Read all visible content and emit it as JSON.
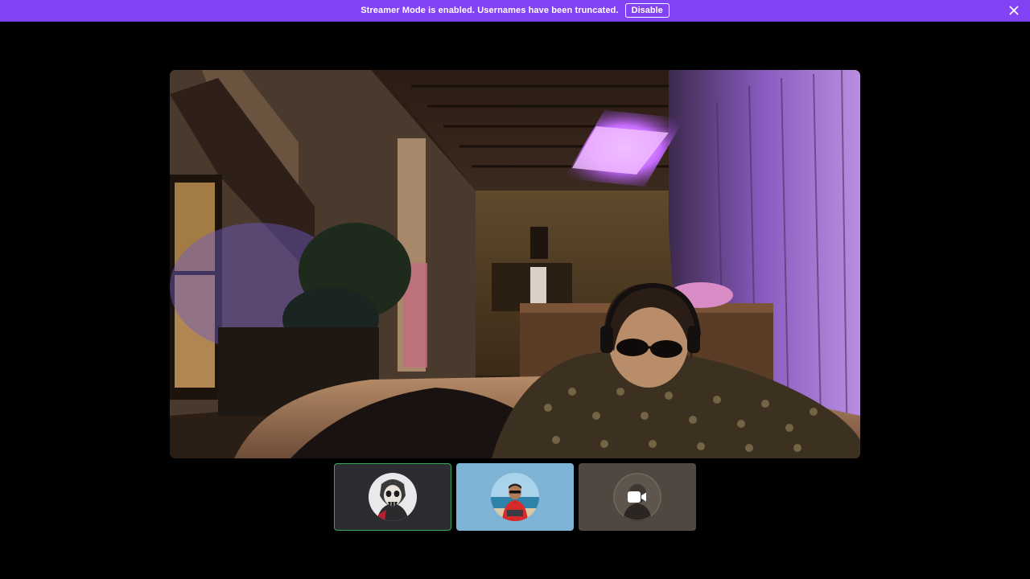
{
  "banner": {
    "message": "Streamer Mode is enabled. Usernames have been truncated.",
    "disable_label": "Disable",
    "background_color": "#8442f5",
    "close_icon": "close-icon"
  },
  "main_video": {
    "content": "webcam-feed"
  },
  "participants": [
    {
      "avatar": "skull-character-avatar",
      "speaking": true,
      "tile_color": "#2b2d31",
      "border_color": "#3ba55d"
    },
    {
      "avatar": "person-red-shirt-avatar",
      "speaking": false,
      "tile_color": "#7fb3d5"
    },
    {
      "avatar": "dim-avatar",
      "speaking": false,
      "tile_color": "#4e4841",
      "overlay_icon": "video-camera-icon"
    }
  ]
}
